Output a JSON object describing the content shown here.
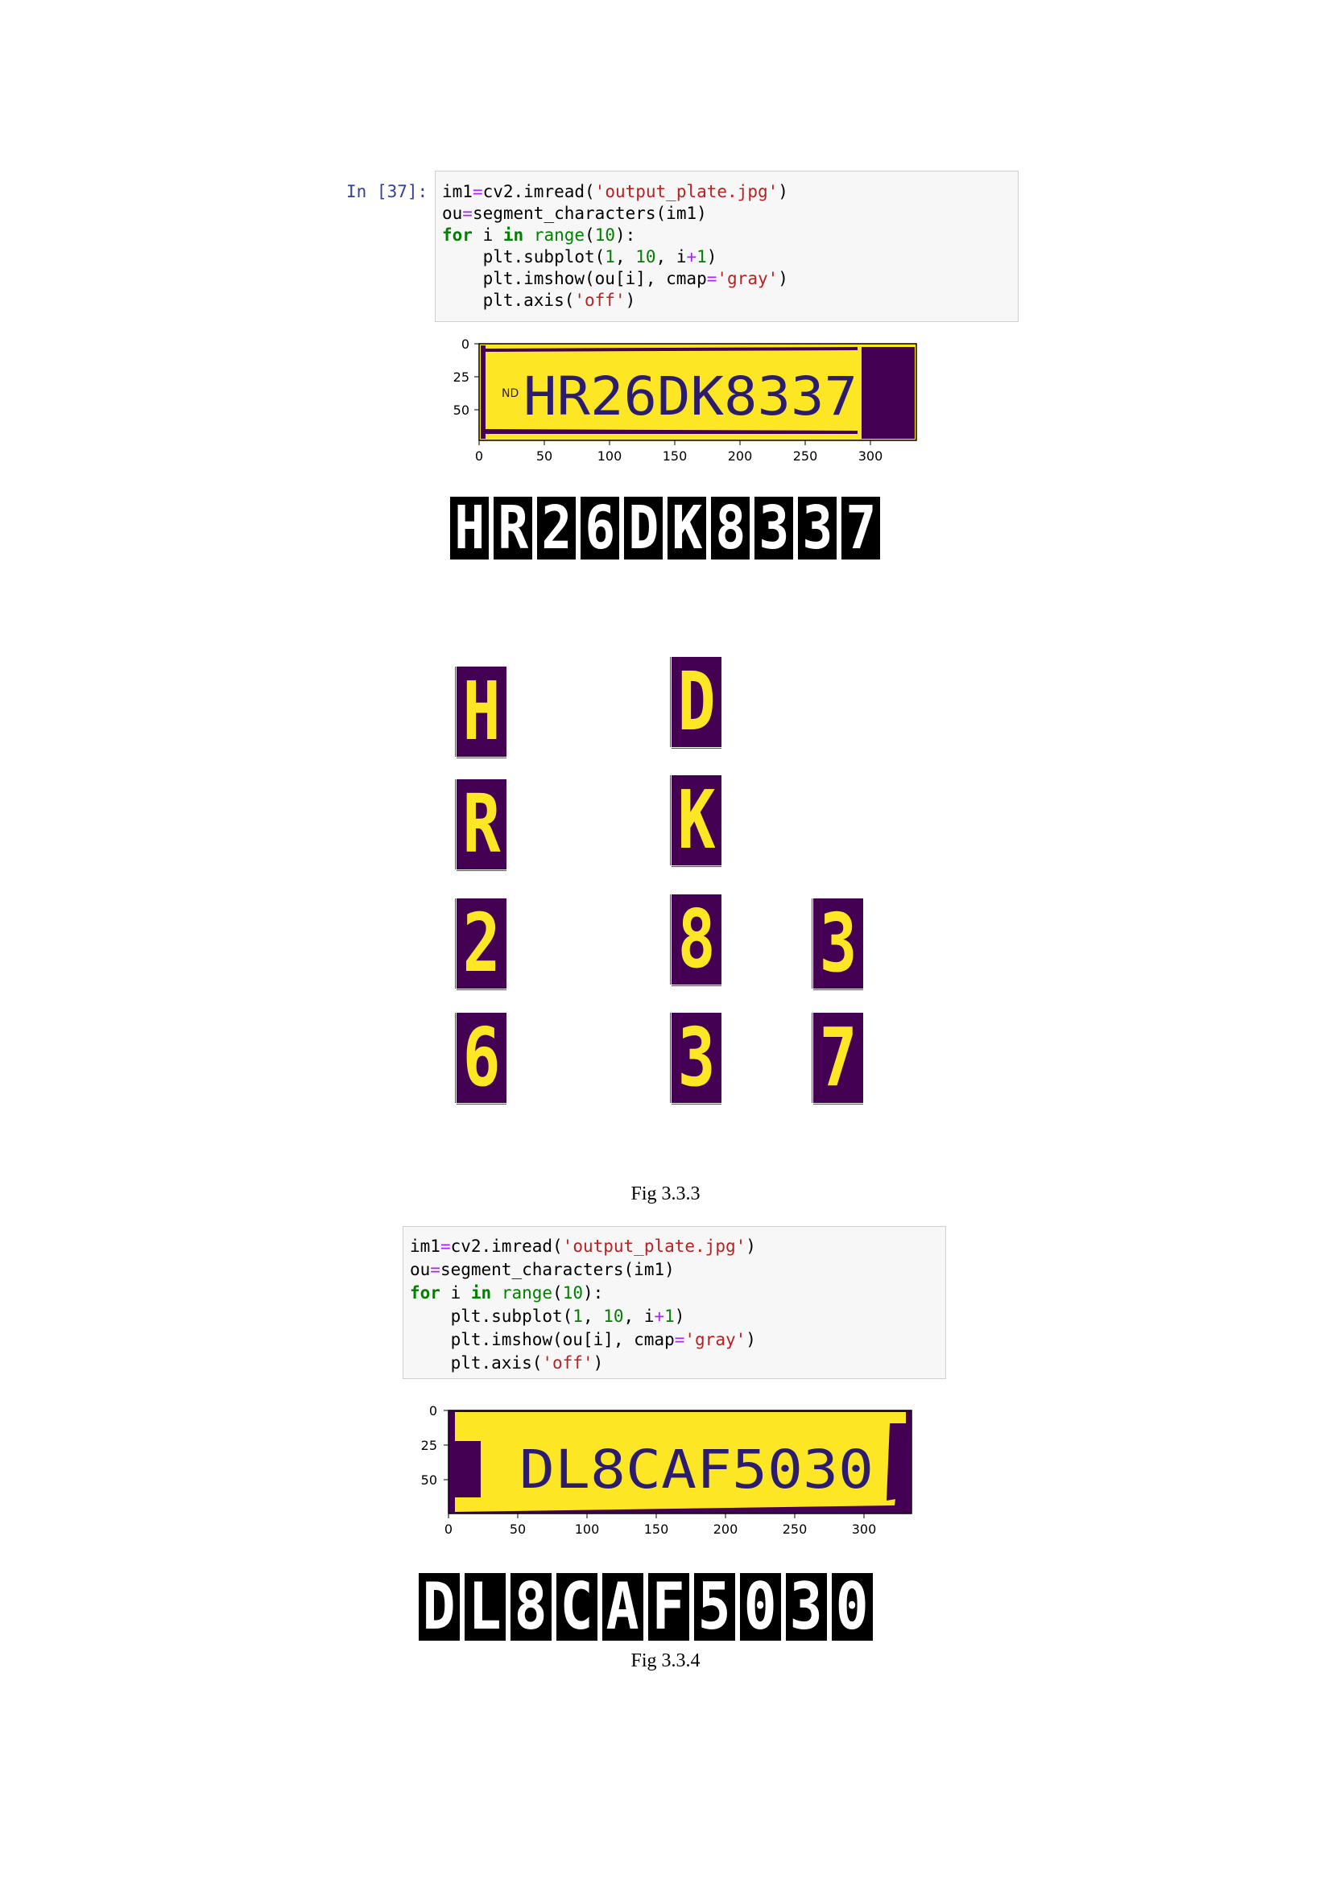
{
  "cell1": {
    "prompt": "In [37]:",
    "code": [
      [
        [
          "",
          "im1"
        ],
        [
          "op",
          "="
        ],
        [
          "",
          "cv2.imread("
        ],
        [
          "st",
          "'output_plate.jpg'"
        ],
        [
          "",
          ")"
        ]
      ],
      [
        [
          "",
          "ou"
        ],
        [
          "op",
          "="
        ],
        [
          "",
          "segment_characters(im1)"
        ]
      ],
      [
        [
          "kw",
          "for"
        ],
        [
          "",
          " i "
        ],
        [
          "kw",
          "in"
        ],
        [
          "",
          " "
        ],
        [
          "bi",
          "range"
        ],
        [
          "",
          "("
        ],
        [
          "nm",
          "10"
        ],
        [
          "",
          "):"
        ]
      ],
      [
        [
          "",
          "    plt.subplot("
        ],
        [
          "nm",
          "1"
        ],
        [
          "",
          ", "
        ],
        [
          "nm",
          "10"
        ],
        [
          "",
          ", i"
        ],
        [
          "op",
          "+"
        ],
        [
          "nm",
          "1"
        ],
        [
          "",
          ")"
        ]
      ],
      [
        [
          "",
          "    plt.imshow(ou[i], cmap"
        ],
        [
          "op",
          "="
        ],
        [
          "st",
          "'gray'"
        ],
        [
          "",
          ")"
        ]
      ],
      [
        [
          "",
          "    plt.axis("
        ],
        [
          "st",
          "'off'"
        ],
        [
          "",
          ")"
        ]
      ]
    ]
  },
  "plate1": {
    "y_ticks": [
      "0",
      "25",
      "50"
    ],
    "x_ticks": [
      "0",
      "50",
      "100",
      "150",
      "200",
      "250",
      "300"
    ],
    "prefix": "ND",
    "text": "HR26DK8337"
  },
  "strip1": [
    "H",
    "R",
    "2",
    "6",
    "D",
    "K",
    "8",
    "3",
    "3",
    "7"
  ],
  "tiles": [
    "H",
    "R",
    "2",
    "6",
    "D",
    "K",
    "8",
    "3",
    "3",
    "7"
  ],
  "caption1": "Fig 3.3.3",
  "cell2": {
    "code": [
      [
        [
          "",
          "im1"
        ],
        [
          "op",
          "="
        ],
        [
          "",
          "cv2.imread("
        ],
        [
          "st",
          "'output_plate.jpg'"
        ],
        [
          "",
          ")"
        ]
      ],
      [
        [
          "",
          "ou"
        ],
        [
          "op",
          "="
        ],
        [
          "",
          "segment_characters(im1)"
        ]
      ],
      [
        [
          "kw",
          "for"
        ],
        [
          "",
          " i "
        ],
        [
          "kw",
          "in"
        ],
        [
          "",
          " "
        ],
        [
          "bi",
          "range"
        ],
        [
          "",
          "("
        ],
        [
          "nm",
          "10"
        ],
        [
          "",
          "):"
        ]
      ],
      [
        [
          "",
          "    plt.subplot("
        ],
        [
          "nm",
          "1"
        ],
        [
          "",
          ", "
        ],
        [
          "nm",
          "10"
        ],
        [
          "",
          ", i"
        ],
        [
          "op",
          "+"
        ],
        [
          "nm",
          "1"
        ],
        [
          "",
          ")"
        ]
      ],
      [
        [
          "",
          "    plt.imshow(ou[i], cmap"
        ],
        [
          "op",
          "="
        ],
        [
          "st",
          "'gray'"
        ],
        [
          "",
          ")"
        ]
      ],
      [
        [
          "",
          "    plt.axis("
        ],
        [
          "st",
          "'off'"
        ],
        [
          "",
          ")"
        ]
      ]
    ]
  },
  "plate2": {
    "y_ticks": [
      "0",
      "25",
      "50"
    ],
    "x_ticks": [
      "0",
      "50",
      "100",
      "150",
      "200",
      "250",
      "300"
    ],
    "text": "DL8CAF5030"
  },
  "strip2": [
    "D",
    "L",
    "8",
    "C",
    "A",
    "F",
    "5",
    "0",
    "3",
    "0"
  ],
  "caption2": "Fig 3.3.4",
  "colors": {
    "plate_yellow": "#fde725",
    "plate_purple": "#440154",
    "ink": "#2b1c6e"
  }
}
